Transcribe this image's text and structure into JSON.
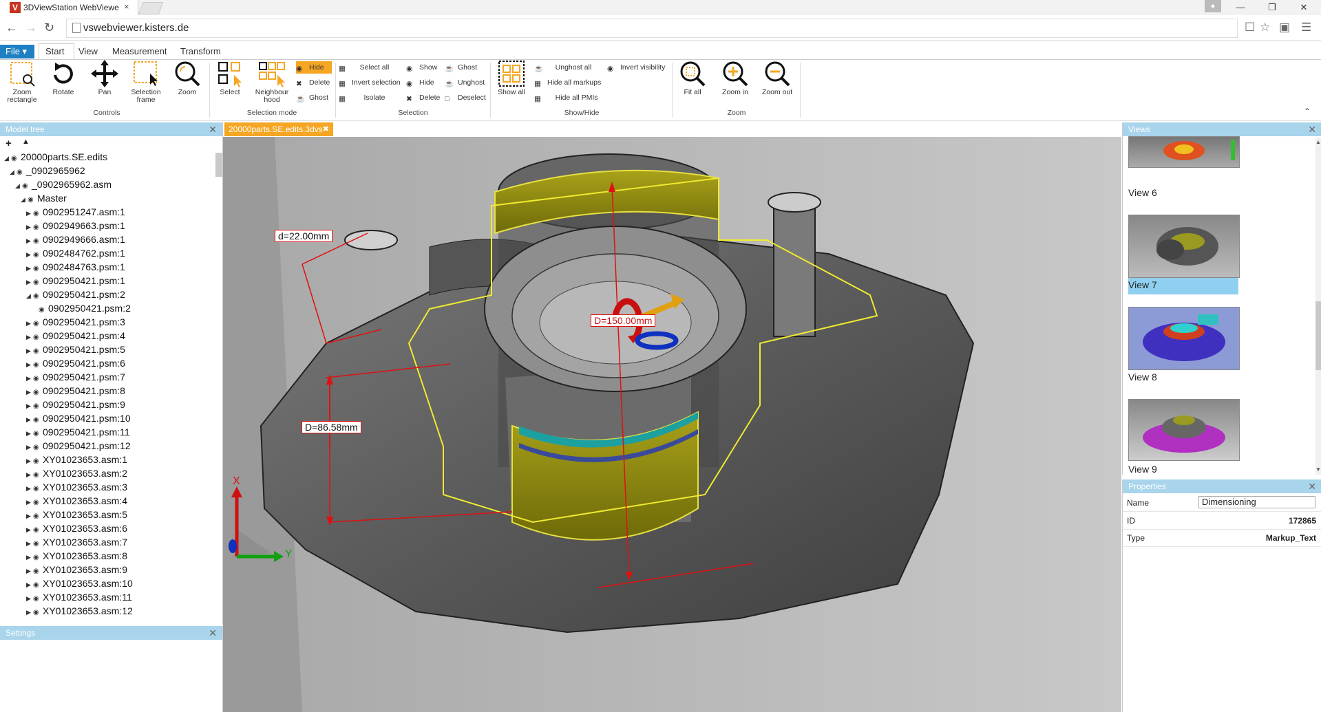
{
  "browser": {
    "tab_title": "3DViewStation WebViewe",
    "tab_close": "×",
    "url": "vswebviewer.kisters.de"
  },
  "ribbon": {
    "file_label": "File ▾",
    "tabs": [
      "Start",
      "View",
      "Measurement",
      "Transform"
    ],
    "controls": {
      "zoom_rectangle": "Zoom rectangle",
      "rotate": "Rotate",
      "pan": "Pan",
      "selection_frame": "Selection frame",
      "zoom": "Zoom",
      "group": "Controls"
    },
    "selection_mode": {
      "select": "Select",
      "neighbourhood": "Neighbour hood",
      "hide": "Hide",
      "delete": "Delete",
      "ghost": "Ghost",
      "group": "Selection mode"
    },
    "selection": {
      "select_all": "Select all",
      "invert_selection": "Invert selection",
      "isolate": "Isolate",
      "show": "Show",
      "hide": "Hide",
      "delete": "Delete",
      "ghost": "Ghost",
      "unghost": "Unghost",
      "deselect": "Deselect",
      "group": "Selection"
    },
    "showhide": {
      "show_all": "Show all",
      "unghost_all": "Unghost all",
      "hide_all_markups": "Hide all markups",
      "hide_all_pmis": "Hide all PMIs",
      "invert_visibility": "Invert visibility",
      "group": "Show/Hide"
    },
    "zoom": {
      "fit_all": "Fit all",
      "zoom_in": "Zoom in",
      "zoom_out": "Zoom out",
      "group": "Zoom"
    }
  },
  "model_tree": {
    "title": "Model tree",
    "items": [
      {
        "label": "20000parts.SE.edits",
        "level": 0,
        "expanded": true
      },
      {
        "label": "_0902965962",
        "level": 1,
        "expanded": true
      },
      {
        "label": "_0902965962.asm",
        "level": 2,
        "expanded": true
      },
      {
        "label": "Master",
        "level": 3,
        "expanded": true
      },
      {
        "label": "0902951247.asm:1",
        "level": 4,
        "expanded": false
      },
      {
        "label": "0902949663.psm:1",
        "level": 4,
        "expanded": false
      },
      {
        "label": "0902949666.asm:1",
        "level": 4,
        "expanded": false
      },
      {
        "label": "0902484762.psm:1",
        "level": 4,
        "expanded": false
      },
      {
        "label": "0902484763.psm:1",
        "level": 4,
        "expanded": false
      },
      {
        "label": "0902950421.psm:1",
        "level": 4,
        "expanded": false
      },
      {
        "label": "0902950421.psm:2",
        "level": 4,
        "expanded": true
      },
      {
        "label": "0902950421.psm:2",
        "level": 5,
        "expanded": null
      },
      {
        "label": "0902950421.psm:3",
        "level": 4,
        "expanded": false
      },
      {
        "label": "0902950421.psm:4",
        "level": 4,
        "expanded": false
      },
      {
        "label": "0902950421.psm:5",
        "level": 4,
        "expanded": false
      },
      {
        "label": "0902950421.psm:6",
        "level": 4,
        "expanded": false
      },
      {
        "label": "0902950421.psm:7",
        "level": 4,
        "expanded": false
      },
      {
        "label": "0902950421.psm:8",
        "level": 4,
        "expanded": false
      },
      {
        "label": "0902950421.psm:9",
        "level": 4,
        "expanded": false
      },
      {
        "label": "0902950421.psm:10",
        "level": 4,
        "expanded": false
      },
      {
        "label": "0902950421.psm:11",
        "level": 4,
        "expanded": false
      },
      {
        "label": "0902950421.psm:12",
        "level": 4,
        "expanded": false
      },
      {
        "label": "XY01023653.asm:1",
        "level": 4,
        "expanded": false
      },
      {
        "label": "XY01023653.asm:2",
        "level": 4,
        "expanded": false
      },
      {
        "label": "XY01023653.asm:3",
        "level": 4,
        "expanded": false
      },
      {
        "label": "XY01023653.asm:4",
        "level": 4,
        "expanded": false
      },
      {
        "label": "XY01023653.asm:5",
        "level": 4,
        "expanded": false
      },
      {
        "label": "XY01023653.asm:6",
        "level": 4,
        "expanded": false
      },
      {
        "label": "XY01023653.asm:7",
        "level": 4,
        "expanded": false
      },
      {
        "label": "XY01023653.asm:8",
        "level": 4,
        "expanded": false
      },
      {
        "label": "XY01023653.asm:9",
        "level": 4,
        "expanded": false
      },
      {
        "label": "XY01023653.asm:10",
        "level": 4,
        "expanded": false
      },
      {
        "label": "XY01023653.asm:11",
        "level": 4,
        "expanded": false
      },
      {
        "label": "XY01023653.asm:12",
        "level": 4,
        "expanded": false
      }
    ]
  },
  "settings": {
    "title": "Settings"
  },
  "document": {
    "tab": "20000parts.SE.edits.3dvs"
  },
  "viewport": {
    "dim_small": "d=22.00mm",
    "dim_large": "D=86.58mm",
    "dim_center": "D=150.00mm",
    "axis_x": "X",
    "axis_y": "Y"
  },
  "views": {
    "title": "Views",
    "items": [
      {
        "label": "View 6",
        "selected": false
      },
      {
        "label": "View 7",
        "selected": true
      },
      {
        "label": "View 8",
        "selected": false
      },
      {
        "label": "View 9",
        "selected": false
      }
    ]
  },
  "properties": {
    "title": "Properties",
    "rows": [
      {
        "key": "Name",
        "value": "Dimensioning"
      },
      {
        "key": "ID",
        "value": "172865"
      },
      {
        "key": "Type",
        "value": "Markup_Text"
      }
    ]
  },
  "colors": {
    "accent_orange": "#f5a623",
    "file_blue": "#1e7fc3",
    "panel_header": "#a8d4ec",
    "selected_view": "#8fd0f0",
    "dimension_red": "#e01010"
  }
}
